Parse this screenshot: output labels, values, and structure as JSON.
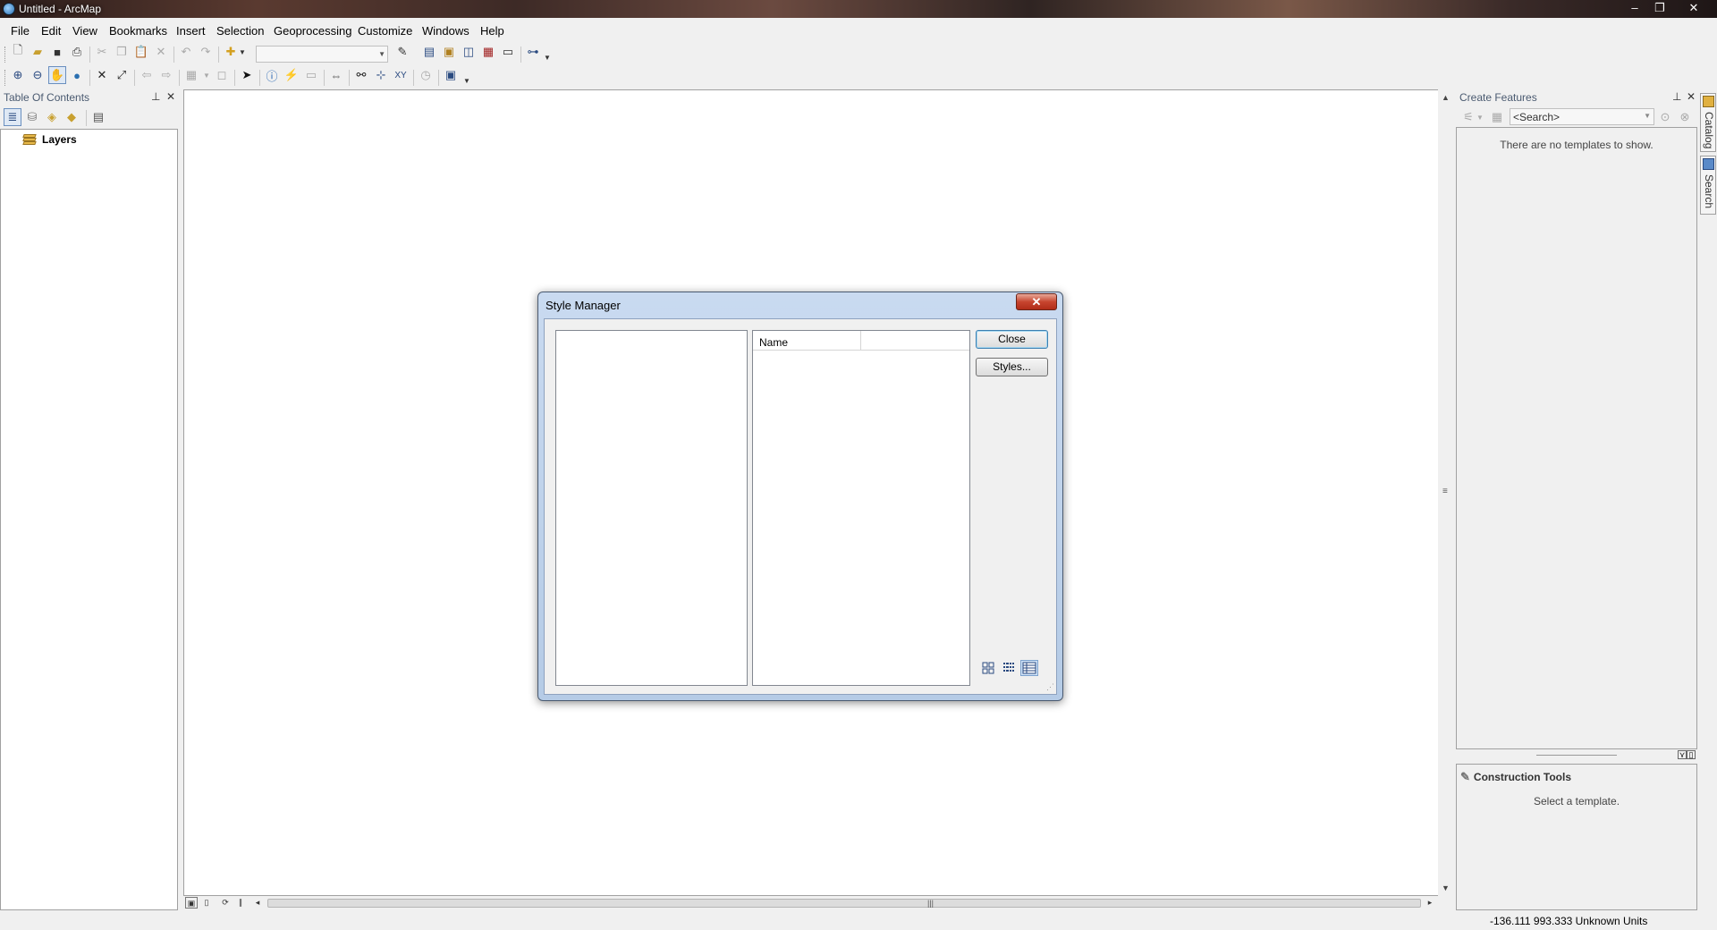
{
  "window": {
    "title": "Untitled - ArcMap",
    "minimize": "‒",
    "restore": "❐",
    "close": "✕"
  },
  "menu": [
    "File",
    "Edit",
    "View",
    "Bookmarks",
    "Insert",
    "Selection",
    "Geoprocessing",
    "Customize",
    "Windows",
    "Help"
  ],
  "toc": {
    "title": "Table Of Contents",
    "root_label": "Layers"
  },
  "create_features": {
    "title": "Create Features",
    "search_placeholder": "<Search>",
    "empty_message": "There are no templates to show."
  },
  "construction_tools": {
    "title": "Construction Tools",
    "message": "Select a template."
  },
  "side_tabs": [
    "Catalog",
    "Search"
  ],
  "status": {
    "coordinates": "-136.111  993.333 Unknown Units"
  },
  "dialog": {
    "title": "Style Manager",
    "columns": [
      "Name",
      ""
    ],
    "buttons": {
      "close": "Close",
      "styles": "Styles..."
    },
    "view_modes": [
      "large-icons",
      "list",
      "details"
    ],
    "selected_view": "details"
  }
}
